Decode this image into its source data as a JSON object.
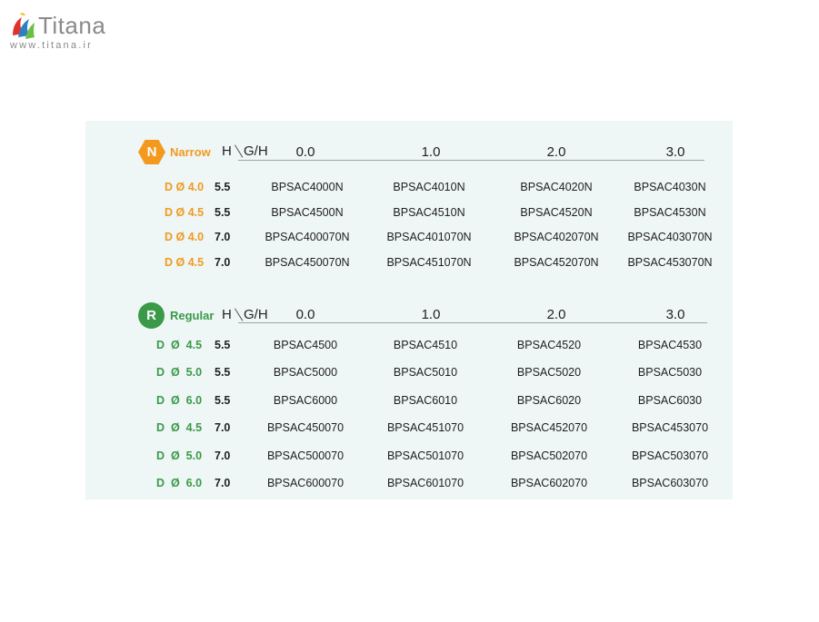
{
  "logo": {
    "name": "Titana",
    "url": "www.titana.ir"
  },
  "columns": [
    "0.0",
    "1.0",
    "2.0",
    "3.0"
  ],
  "header": {
    "h": "H",
    "gh": "G/H"
  },
  "narrow": {
    "badge": "N",
    "label": "Narrow",
    "color": "#f39a1e",
    "rows": [
      {
        "d": "D Ø 4.0",
        "h": "5.5",
        "codes": [
          "BPSAC4000N",
          "BPSAC4010N",
          "BPSAC4020N",
          "BPSAC4030N"
        ]
      },
      {
        "d": "D Ø 4.5",
        "h": "5.5",
        "codes": [
          "BPSAC4500N",
          "BPSAC4510N",
          "BPSAC4520N",
          "BPSAC4530N"
        ]
      },
      {
        "d": "D Ø 4.0",
        "h": "7.0",
        "codes": [
          "BPSAC400070N",
          "BPSAC401070N",
          "BPSAC402070N",
          "BPSAC403070N"
        ]
      },
      {
        "d": "D Ø 4.5",
        "h": "7.0",
        "codes": [
          "BPSAC450070N",
          "BPSAC451070N",
          "BPSAC452070N",
          "BPSAC453070N"
        ]
      }
    ]
  },
  "regular": {
    "badge": "R",
    "label": "Regular",
    "color": "#3a9a48",
    "rows": [
      {
        "d": "D  Ø  4.5",
        "h": "5.5",
        "codes": [
          "BPSAC4500",
          "BPSAC4510",
          "BPSAC4520",
          "BPSAC4530"
        ]
      },
      {
        "d": "D  Ø  5.0",
        "h": "5.5",
        "codes": [
          "BPSAC5000",
          "BPSAC5010",
          "BPSAC5020",
          "BPSAC5030"
        ]
      },
      {
        "d": "D  Ø  6.0",
        "h": "5.5",
        "codes": [
          "BPSAC6000",
          "BPSAC6010",
          "BPSAC6020",
          "BPSAC6030"
        ]
      },
      {
        "d": "D  Ø  4.5",
        "h": "7.0",
        "codes": [
          "BPSAC450070",
          "BPSAC451070",
          "BPSAC452070",
          "BPSAC453070"
        ]
      },
      {
        "d": "D  Ø  5.0",
        "h": "7.0",
        "codes": [
          "BPSAC500070",
          "BPSAC501070",
          "BPSAC502070",
          "BPSAC503070"
        ]
      },
      {
        "d": "D  Ø  6.0",
        "h": "7.0",
        "codes": [
          "BPSAC600070",
          "BPSAC601070",
          "BPSAC602070",
          "BPSAC603070"
        ]
      }
    ]
  }
}
